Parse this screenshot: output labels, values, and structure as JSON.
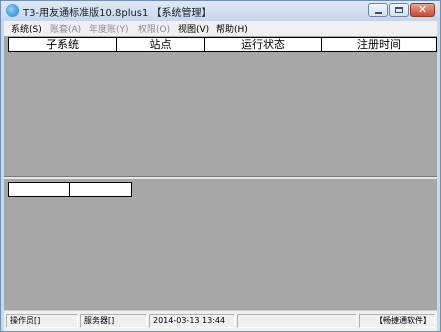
{
  "window": {
    "title": "T3-用友通标准版10.8plus1 【系统管理】",
    "close_glyph": "✕"
  },
  "menu": {
    "items": [
      {
        "label": "系统(S)"
      },
      {
        "label": "账套(A)"
      },
      {
        "label": "年度账(Y)"
      },
      {
        "label": "权限(O)"
      },
      {
        "label": "视图(V)"
      },
      {
        "label": "帮助(H)"
      }
    ]
  },
  "grid": {
    "columns": [
      "子系统",
      "站点",
      "运行状态",
      "注册时间"
    ]
  },
  "statusbar": {
    "operator": "操作员[]",
    "server": "服务器[]",
    "datetime": "2014-03-13  13:44",
    "brand": "【畅捷通软件】"
  }
}
